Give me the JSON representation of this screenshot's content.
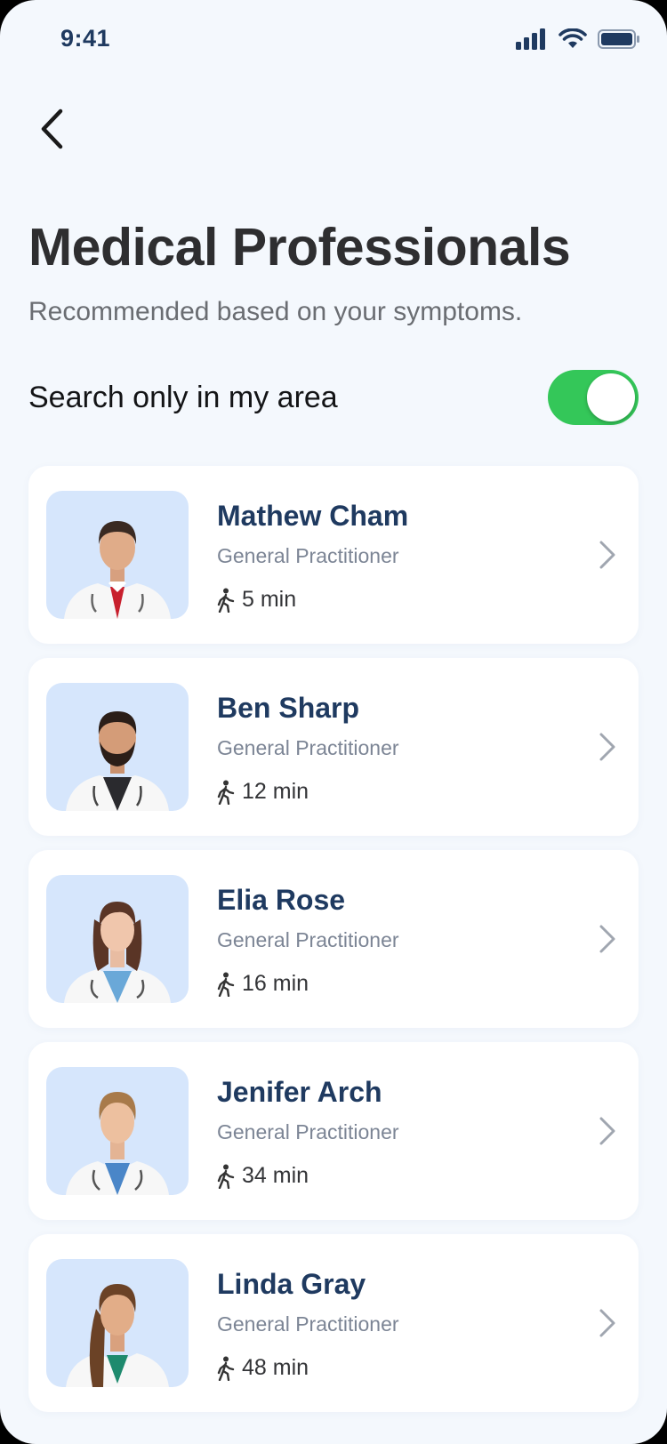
{
  "status_bar": {
    "time": "9:41"
  },
  "header": {
    "title": "Medical Professionals",
    "subtitle": "Recommended based on your symptoms."
  },
  "area_filter": {
    "label": "Search only in my area",
    "enabled": true
  },
  "doctors": [
    {
      "name": "Mathew Cham",
      "role": "General Practitioner",
      "walk_time": "5 min"
    },
    {
      "name": "Ben Sharp",
      "role": "General Practitioner",
      "walk_time": "12 min"
    },
    {
      "name": "Elia Rose",
      "role": "General Practitioner",
      "walk_time": "16 min"
    },
    {
      "name": "Jenifer Arch",
      "role": "General Practitioner",
      "walk_time": "34 min"
    },
    {
      "name": "Linda Gray",
      "role": "General Practitioner",
      "walk_time": "48 min"
    }
  ],
  "colors": {
    "background": "#F4F8FD",
    "accent_navy": "#1F3A60",
    "toggle_on": "#34C759",
    "avatar_bg": "#D6E6FC"
  },
  "icons": [
    "back-chevron-icon",
    "cellular-signal-icon",
    "wifi-icon",
    "battery-icon",
    "walking-icon",
    "chevron-right-icon"
  ]
}
